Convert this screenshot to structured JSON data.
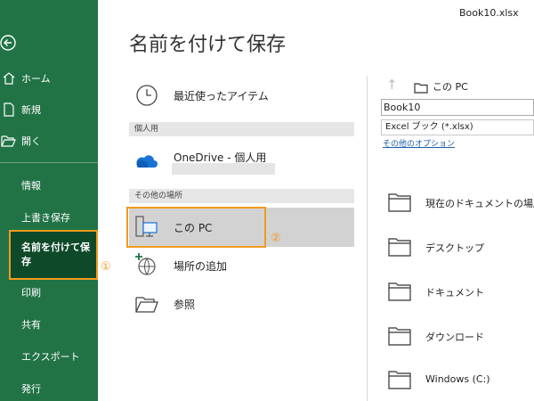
{
  "header": {
    "title": "名前を付けて保存",
    "file_name": "Book10.xlsx"
  },
  "sidebar": {
    "items": [
      {
        "label": "ホーム",
        "icon": "home-icon"
      },
      {
        "label": "新規",
        "icon": "new-file-icon"
      },
      {
        "label": "開く",
        "icon": "open-folder-icon"
      }
    ],
    "sub_items": [
      "情報",
      "上書き保存",
      "名前を付けて保存",
      "印刷",
      "共有",
      "エクスポート",
      "発行"
    ],
    "active": "名前を付けて保存"
  },
  "locations": {
    "recent": "最近使ったアイテム",
    "personal_header": "個人用",
    "onedrive": "OneDrive - 個人用",
    "other_header": "その他の場所",
    "this_pc": "この PC",
    "add_place": "場所の追加",
    "browse": "参照"
  },
  "annotations": {
    "sidebar_badge": "①",
    "location_badge": "②"
  },
  "save_panel": {
    "current_location": "この PC",
    "file_name_value": "Book10",
    "file_type": "Excel ブック (*.xlsx)",
    "more_options": "その他のオプション",
    "folders": [
      "現在のドキュメントの場所",
      "デスクトップ",
      "ドキュメント",
      "ダウンロード",
      "Windows (C:)"
    ]
  },
  "colors": {
    "accent": "#217346",
    "highlight": "#f39a1e",
    "link": "#1f5fa8"
  }
}
